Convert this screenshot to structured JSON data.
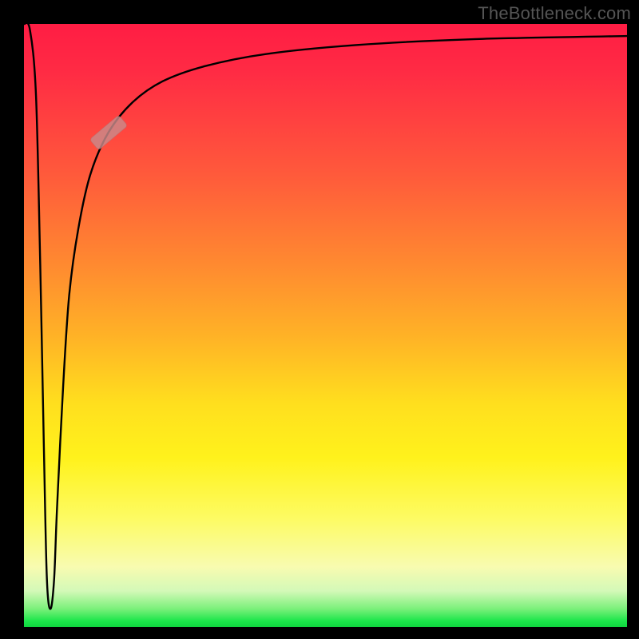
{
  "watermark": "TheBottleneck.com",
  "chart_data": {
    "type": "line",
    "title": "",
    "xlabel": "",
    "ylabel": "",
    "xlim": [
      0,
      100
    ],
    "ylim": [
      0,
      100
    ],
    "grid": false,
    "legend": false,
    "background_gradient": {
      "orientation": "vertical",
      "stops": [
        {
          "pos": 0.0,
          "color": "#ff1d44"
        },
        {
          "pos": 0.25,
          "color": "#ff5a3b"
        },
        {
          "pos": 0.5,
          "color": "#ffb326"
        },
        {
          "pos": 0.72,
          "color": "#fff21c"
        },
        {
          "pos": 0.9,
          "color": "#f8fbb0"
        },
        {
          "pos": 0.97,
          "color": "#7af07a"
        },
        {
          "pos": 1.0,
          "color": "#0fd63f"
        }
      ]
    },
    "series": [
      {
        "name": "bottleneck-curve",
        "x": [
          0.0,
          1.0,
          2.0,
          2.7,
          3.3,
          3.8,
          4.4,
          5.0,
          5.5,
          6.5,
          7.5,
          9.0,
          11.0,
          14.0,
          18.0,
          23.0,
          30.0,
          40.0,
          55.0,
          75.0,
          100.0
        ],
        "y": [
          100.0,
          99.0,
          88.0,
          60.0,
          30.0,
          8.0,
          3.0,
          8.0,
          20.0,
          40.0,
          55.0,
          66.0,
          75.0,
          82.0,
          87.0,
          90.5,
          93.0,
          95.0,
          96.5,
          97.5,
          98.0
        ]
      }
    ],
    "marker": {
      "series": "bottleneck-curve",
      "x": 14.0,
      "y": 82.0,
      "angle_deg": 40
    }
  }
}
